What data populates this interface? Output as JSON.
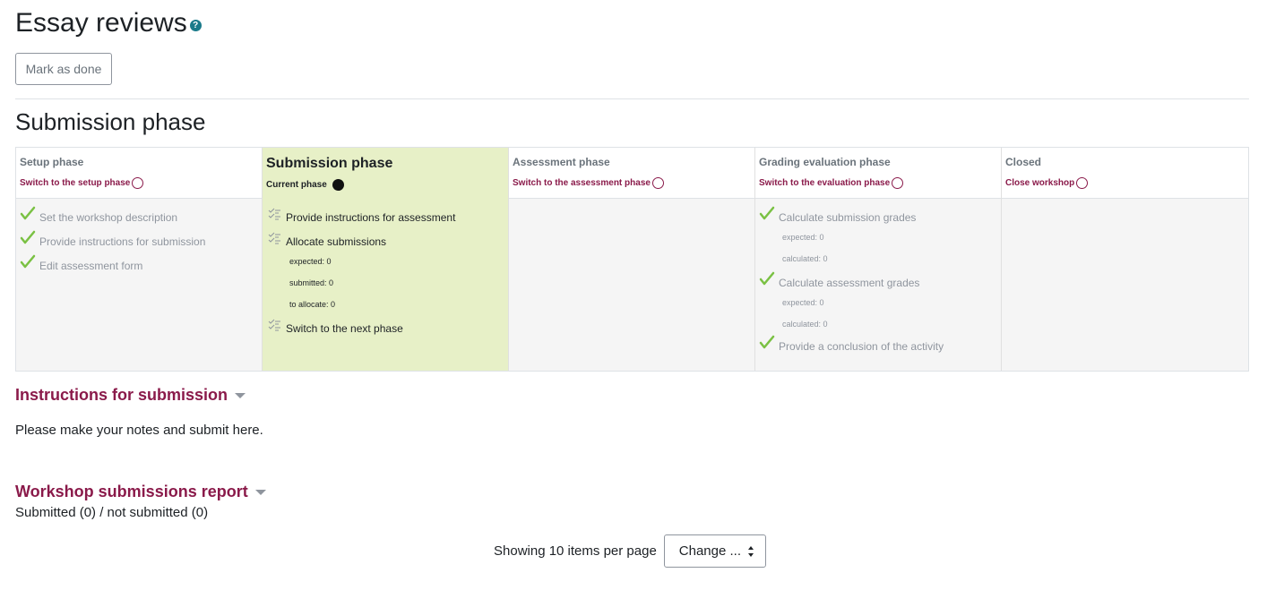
{
  "header": {
    "title": "Essay reviews",
    "help_icon": "question-circle-icon",
    "mark_done_label": "Mark as done"
  },
  "current_phase_heading": "Submission phase",
  "phases": [
    {
      "title": "Setup phase",
      "action": "Switch to the setup phase",
      "action_icon": "circle-outline-icon",
      "tasks": [
        {
          "label": "Set the workshop description",
          "status": "done",
          "details": []
        },
        {
          "label": "Provide instructions for submission",
          "status": "done",
          "details": []
        },
        {
          "label": "Edit assessment form",
          "status": "done",
          "details": []
        }
      ]
    },
    {
      "title": "Submission phase",
      "action": "Current phase",
      "action_icon": "filled-circle-icon",
      "active": true,
      "tasks": [
        {
          "label": "Provide instructions for assessment",
          "status": "todo",
          "details": []
        },
        {
          "label": "Allocate submissions",
          "status": "todo",
          "details": [
            "expected: 0",
            "submitted: 0",
            "to allocate: 0"
          ]
        },
        {
          "label": "Switch to the next phase",
          "status": "todo",
          "details": []
        }
      ]
    },
    {
      "title": "Assessment phase",
      "action": "Switch to the assessment phase",
      "action_icon": "circle-outline-icon",
      "tasks": []
    },
    {
      "title": "Grading evaluation phase",
      "action": "Switch to the evaluation phase",
      "action_icon": "circle-outline-icon",
      "tasks": [
        {
          "label": "Calculate submission grades",
          "status": "done",
          "details": [
            "expected: 0",
            "calculated: 0"
          ]
        },
        {
          "label": "Calculate assessment grades",
          "status": "done",
          "details": [
            "expected: 0",
            "calculated: 0"
          ]
        },
        {
          "label": "Provide a conclusion of the activity",
          "status": "done",
          "details": []
        }
      ]
    },
    {
      "title": "Closed",
      "action": "Close workshop",
      "action_icon": "circle-outline-icon",
      "tasks": []
    }
  ],
  "instructions": {
    "heading": "Instructions for submission",
    "text": "Please make your notes and submit here."
  },
  "report": {
    "heading": "Workshop submissions report",
    "summary": "Submitted (0) / not submitted (0)"
  },
  "paging": {
    "label": "Showing 10 items per page",
    "select_value": "Change ..."
  },
  "colors": {
    "accent": "#8a1a4a",
    "active_phase_bg": "#e7f0c7",
    "check": "#7ac143"
  }
}
